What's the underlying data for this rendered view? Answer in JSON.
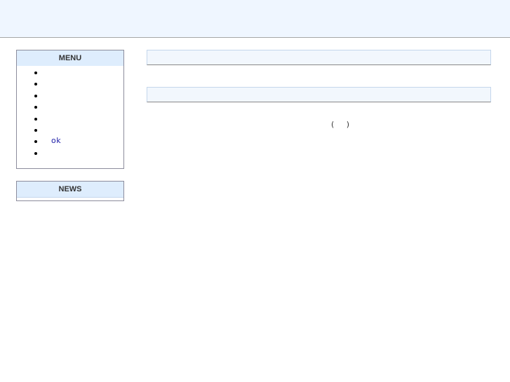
{
  "sidebar": {
    "menu": {
      "title": "MENU",
      "items": [
        {
          "label": ""
        },
        {
          "label": ""
        },
        {
          "label": ""
        },
        {
          "label": ""
        },
        {
          "label": ""
        },
        {
          "label": ""
        },
        {
          "label": "ok"
        },
        {
          "label": ""
        }
      ]
    },
    "news": {
      "title": "NEWS"
    }
  },
  "main": {
    "section_1_title": "",
    "section_2_title": "",
    "parenthetical": "(     )"
  }
}
